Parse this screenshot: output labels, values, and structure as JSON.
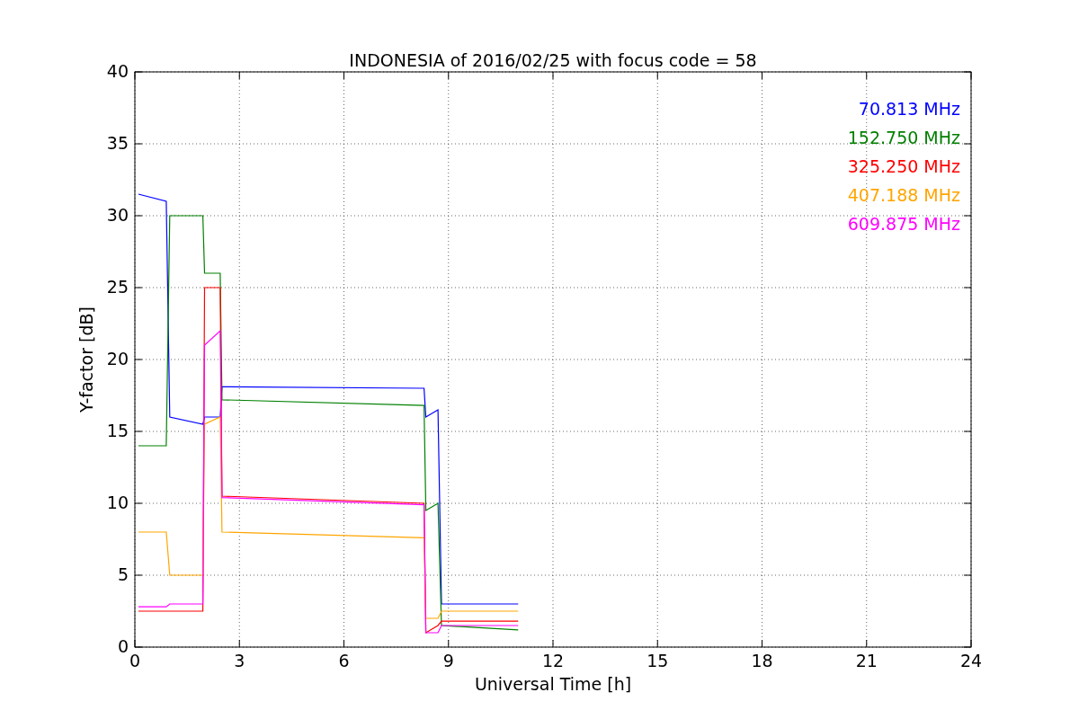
{
  "chart_data": {
    "type": "line",
    "title": "INDONESIA of 2016/02/25 with focus code = 58",
    "xlabel": "Universal Time [h]",
    "ylabel": "Y-factor [dB]",
    "x": [
      0.1,
      0.9,
      1.0,
      1.95,
      2.0,
      2.45,
      2.5,
      8.3,
      8.35,
      8.7,
      8.8,
      11
    ],
    "series": [
      {
        "name": "70.813 MHz",
        "color": "#0000ff",
        "values": [
          31.5,
          31,
          16,
          15.5,
          16,
          16,
          18.1,
          18,
          16,
          16.5,
          3,
          3
        ]
      },
      {
        "name": "152.750 MHz",
        "color": "#008000",
        "values": [
          14,
          14,
          30,
          30,
          26,
          26,
          17.2,
          16.8,
          9.5,
          10,
          1.5,
          1.2
        ]
      },
      {
        "name": "325.250 MHz",
        "color": "#ff0000",
        "values": [
          2.5,
          2.5,
          2.5,
          2.5,
          25,
          25,
          10.5,
          10,
          1,
          1.5,
          1.8,
          1.8
        ]
      },
      {
        "name": "407.188 MHz",
        "color": "#ffa500",
        "values": [
          8,
          8,
          5,
          5,
          15.5,
          16,
          8,
          7.6,
          2,
          2,
          2.5,
          2.5
        ]
      },
      {
        "name": "609.875 MHz",
        "color": "#ff00ff",
        "values": [
          2.8,
          2.8,
          3,
          3,
          21,
          22,
          10.4,
          9.9,
          1,
          1,
          1.5,
          1.5
        ]
      }
    ],
    "grid": true,
    "xlim": [
      0,
      24
    ],
    "ylim": [
      0,
      40
    ],
    "xticks": [
      0,
      3,
      6,
      9,
      12,
      15,
      18,
      21,
      24
    ],
    "yticks": [
      0,
      5,
      10,
      15,
      20,
      25,
      30,
      35,
      40
    ]
  }
}
